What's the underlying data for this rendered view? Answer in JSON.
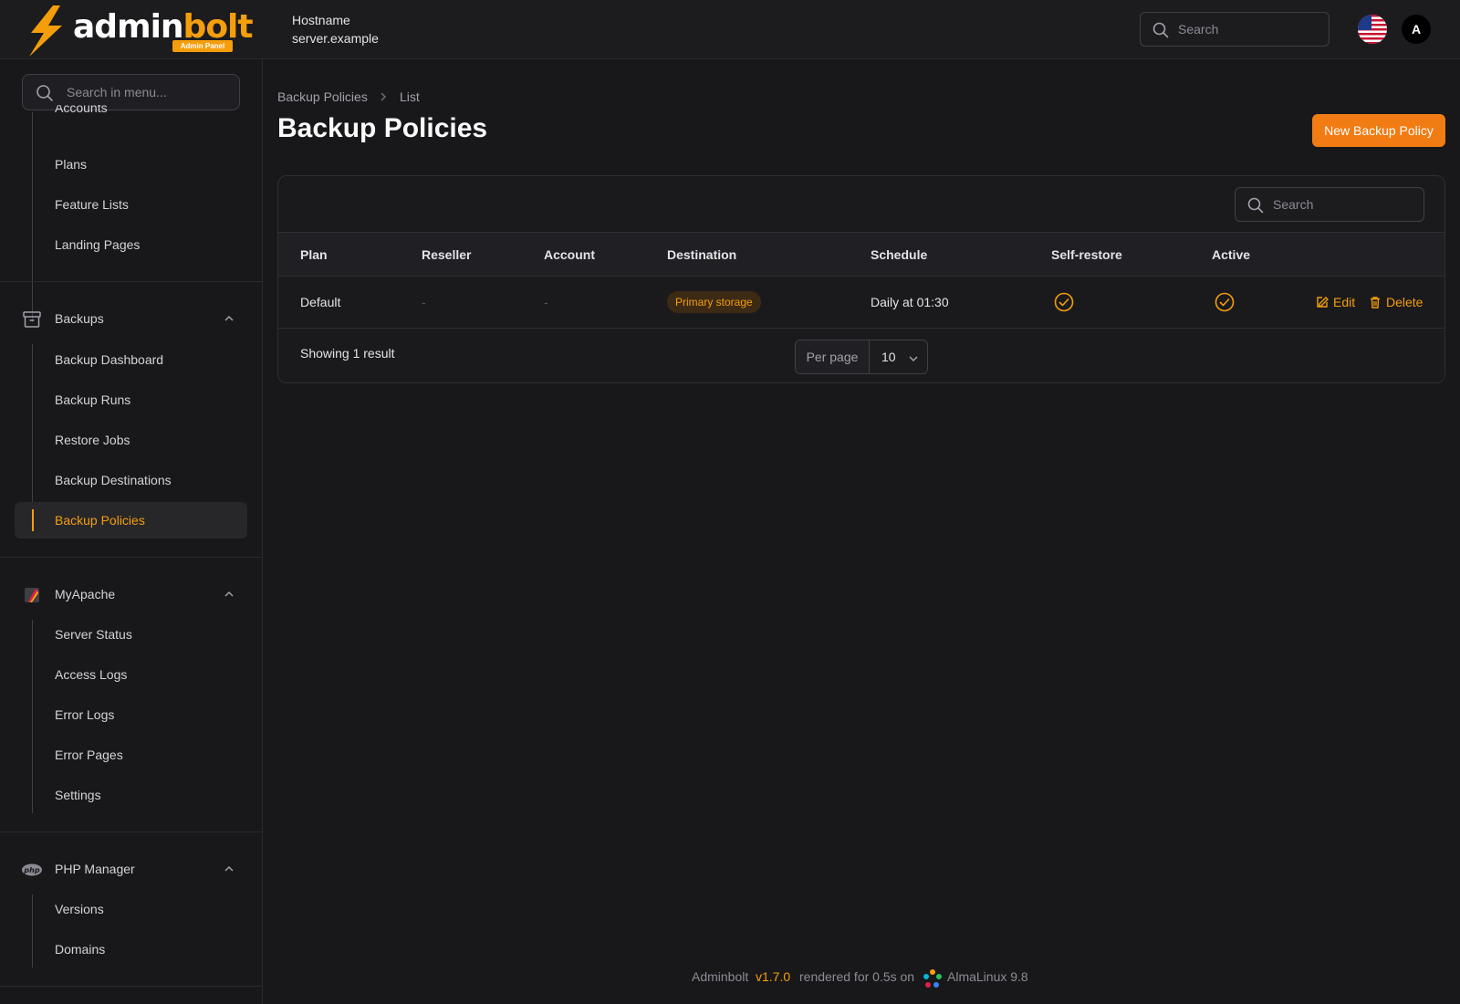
{
  "app": {
    "logo_text_white": "admin",
    "logo_text_orange": "bolt",
    "logo_badge": "Admin Panel",
    "hostname_label": "Hostname",
    "hostname_value": "server.example",
    "search_placeholder": "Search",
    "avatar_initial": "A",
    "accent_color": "#f27c14"
  },
  "sidebar": {
    "search_placeholder": "Search in menu...",
    "top_items": [
      {
        "label": "Accounts"
      },
      {
        "label": "Plans"
      },
      {
        "label": "Feature Lists"
      },
      {
        "label": "Landing Pages"
      }
    ],
    "groups": [
      {
        "label": "Backups",
        "icon": "archive-icon",
        "items": [
          {
            "label": "Backup Dashboard"
          },
          {
            "label": "Backup Runs"
          },
          {
            "label": "Restore Jobs"
          },
          {
            "label": "Backup Destinations"
          },
          {
            "label": "Backup Policies",
            "active": true
          }
        ]
      },
      {
        "label": "MyApache",
        "icon": "apache-feather-icon",
        "items": [
          {
            "label": "Server Status"
          },
          {
            "label": "Access Logs"
          },
          {
            "label": "Error Logs"
          },
          {
            "label": "Error Pages"
          },
          {
            "label": "Settings"
          }
        ]
      },
      {
        "label": "PHP Manager",
        "icon": "php-icon",
        "items": [
          {
            "label": "Versions"
          },
          {
            "label": "Domains"
          }
        ]
      }
    ]
  },
  "breadcrumb": [
    "Backup Policies",
    "List"
  ],
  "page": {
    "title": "Backup Policies",
    "new_button": "New Backup Policy"
  },
  "table": {
    "search_placeholder": "Search",
    "columns": [
      "Plan",
      "Reseller",
      "Account",
      "Destination",
      "Schedule",
      "Self-restore",
      "Active"
    ],
    "rows": [
      {
        "plan": "Default",
        "reseller": "-",
        "account": "-",
        "destination": "Primary storage",
        "schedule": "Daily at 01:30",
        "self_restore": true,
        "active": true,
        "edit_label": "Edit",
        "delete_label": "Delete"
      }
    ],
    "showing": "Showing 1 result",
    "per_page_label": "Per page",
    "per_page_value": "10"
  },
  "footer": {
    "product": "Adminbolt",
    "version": "v1.7.0",
    "rendered": "rendered for 0.5s on",
    "os": "AlmaLinux 9.8"
  }
}
